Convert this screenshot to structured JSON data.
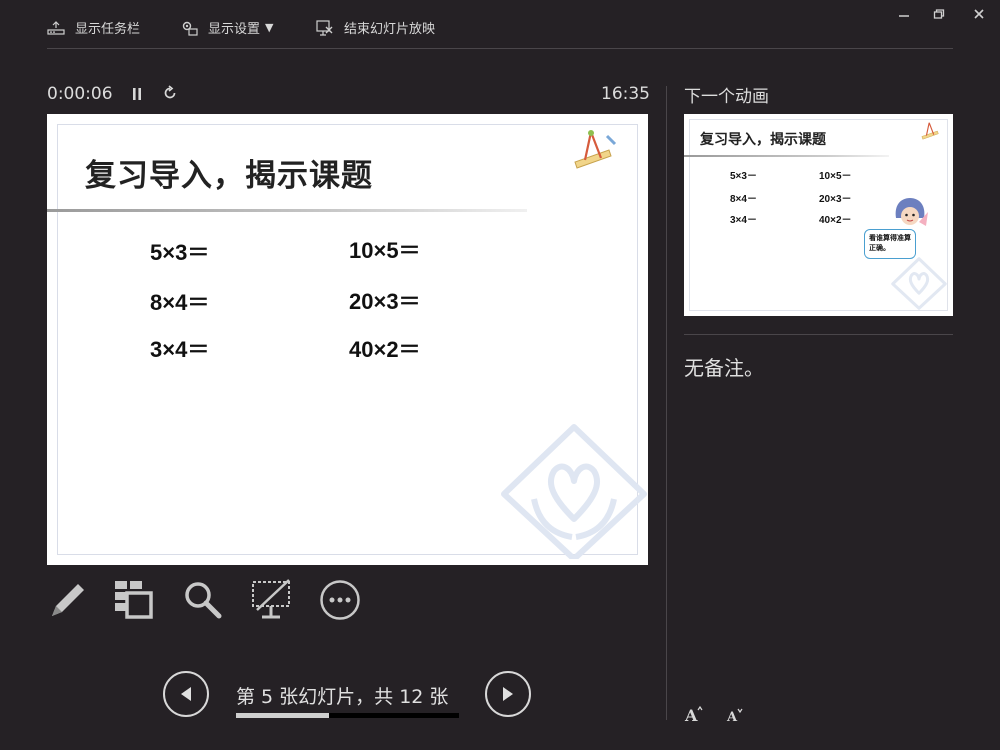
{
  "toolbar": {
    "show_taskbar": "显示任务栏",
    "display_settings": "显示设置",
    "display_settings_caret": "▼",
    "end_show": "结束幻灯片放映"
  },
  "window": {
    "minimize_icon": "minimize-icon",
    "restore_icon": "restore-icon",
    "close_icon": "close-icon"
  },
  "timer": {
    "elapsed": "0:00:06",
    "clock": "16:35"
  },
  "slide": {
    "title": "复习导入，揭示课题",
    "equations": [
      "5×3＝",
      "8×4＝",
      "3×4＝",
      "10×5＝",
      "20×3＝",
      "40×2＝"
    ]
  },
  "next": {
    "label": "下一个动画",
    "thumb_title": "复习导入，揭示课题",
    "equations": [
      "5×3－",
      "8×4－",
      "3×4－",
      "10×5－",
      "20×3－",
      "40×2－"
    ],
    "bubble_text": "看谁算得准算正确。"
  },
  "notes": {
    "text": "无备注。",
    "font_increase_icon": "font-increase-icon",
    "font_decrease_icon": "font-decrease-icon"
  },
  "tools": [
    "pen-icon",
    "see-all-slides-icon",
    "zoom-icon",
    "black-screen-icon",
    "more-options-icon"
  ],
  "navigation": {
    "counter": "第 5 张幻灯片，共 12 张",
    "current": 5,
    "total": 12,
    "progress_fraction": 0.416
  },
  "colors": {
    "background": "#252125",
    "text": "#e6e6e6",
    "accent_blue": "#4a9fd0"
  }
}
